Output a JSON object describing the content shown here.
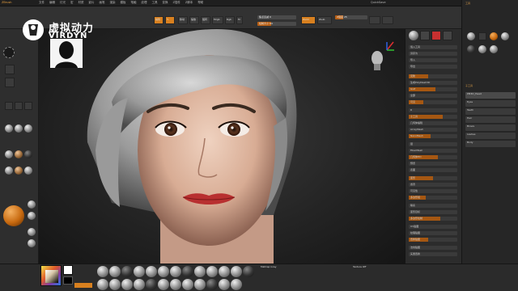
{
  "app": {
    "window_title": "ZBrush",
    "right_title": "QuickSave",
    "menu_items": [
      "文件",
      "编辑",
      "灯光",
      "宏",
      "材质",
      "影片",
      "画笔",
      "渲染",
      "模板",
      "笔触",
      "纹理",
      "工具",
      "变换",
      "Z插件",
      "Z脚本",
      "帮助"
    ]
  },
  "logo": {
    "cn_text": "虚拟动力",
    "en_text": "VIRDYN"
  },
  "toolbar": {
    "buttons": [
      {
        "label": "编辑",
        "active": true
      },
      {
        "label": "移动",
        "active": false
      },
      {
        "label": "缩放",
        "active": false
      },
      {
        "label": "旋转",
        "active": false
      },
      {
        "label": "Mrgb",
        "active": false
      },
      {
        "label": "Rgb",
        "active": false
      },
      {
        "label": "M",
        "active": false
      },
      {
        "label": "Zadd",
        "active": true
      },
      {
        "label": "Zsub",
        "active": false
      }
    ],
    "sliders": [
      {
        "label": "焦点衰减 0",
        "fill": 0.0
      },
      {
        "label": "绘制大小 64",
        "fill": 0.35
      },
      {
        "label": "Z强度 25",
        "fill": 0.25
      }
    ]
  },
  "colors": {
    "accent": "#d8801f",
    "panel": "#2c2c2c",
    "viewport_bg": "#1e1e1e"
  },
  "right_panel": {
    "header": "工具",
    "rows": [
      "载入工具",
      "另存为",
      "导入",
      "导出",
      "克隆",
      "生成PolyMesh3D",
      "GoZ",
      "全部",
      "可见",
      "R",
      "子工具",
      "几何体编辑",
      "ArrayMesh",
      "NanoMesh",
      "层",
      "FiberMesh",
      "几何体HD",
      "预览",
      "表面",
      "变形",
      "遮罩",
      "可见性",
      "多边形组",
      "联系",
      "变形目标",
      "多边形绘制",
      "UV贴图",
      "纹理贴图",
      "置换贴图",
      "法线贴图",
      "矢量置换",
      "显示属性",
      "统一蒙皮",
      "初始化",
      "导入",
      "导出"
    ]
  },
  "far_right": {
    "header": "子工具",
    "items": [
      "PM3D_Head",
      "Eyes",
      "Teeth",
      "Hair",
      "Brows",
      "Lashes",
      "Body"
    ]
  },
  "bottom_bar": {
    "brushes": [
      "Standard",
      "ClayBuildup",
      "Move",
      "DamStd",
      "hPolish",
      "TrimDyn",
      "Inflat",
      "Pinch",
      "Smooth",
      "Clay",
      "Dam",
      "Slash",
      "Layer",
      "Flatten",
      "Nudge",
      "Snake",
      "Blob",
      "Curve",
      "Mask",
      "Select",
      "Clip",
      "Planar",
      "Trim",
      "Polish",
      "Form"
    ],
    "material_label": "MatCap Gray",
    "texture_label": "Texture Off"
  },
  "viewport": {
    "subject": "female head sculpt"
  }
}
